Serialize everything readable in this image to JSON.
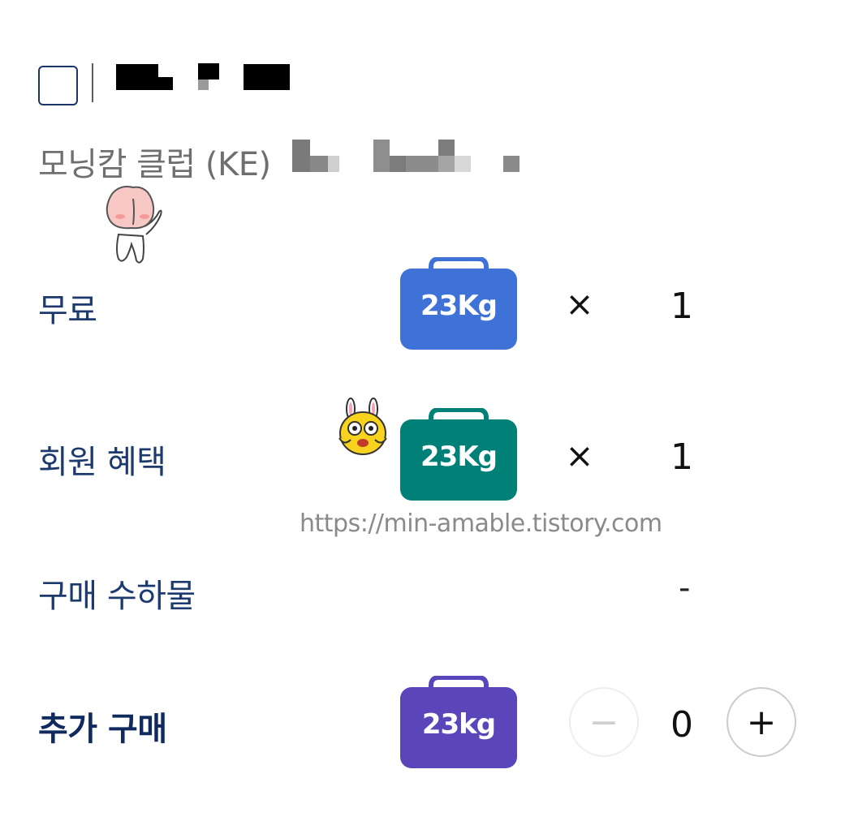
{
  "passenger": {
    "checkbox_checked": false,
    "club_label": "모닝캄 클럽 (KE)"
  },
  "baggage": {
    "free": {
      "label": "무료",
      "bag_weight": "23Kg",
      "bag_color": "#3f72d6",
      "times": "×",
      "count": "1"
    },
    "member": {
      "label": "회원 혜택",
      "bag_weight": "23Kg",
      "bag_color": "#008077",
      "times": "×",
      "count": "1"
    },
    "purchased": {
      "label": "구매 수하물",
      "value": "-"
    },
    "extra": {
      "label": "추가 구매",
      "bag_weight": "23kg",
      "bag_color": "#5a45bb",
      "minus": "−",
      "count": "0",
      "plus": "+"
    }
  },
  "watermark": "https://min-amable.tistory.com",
  "colors": {
    "label_navy": "#1c3a6e",
    "muted_text": "#6f6f6f"
  },
  "icons": {
    "sticker_1": "peach-character-sticker",
    "sticker_2": "bunny-character-sticker"
  }
}
